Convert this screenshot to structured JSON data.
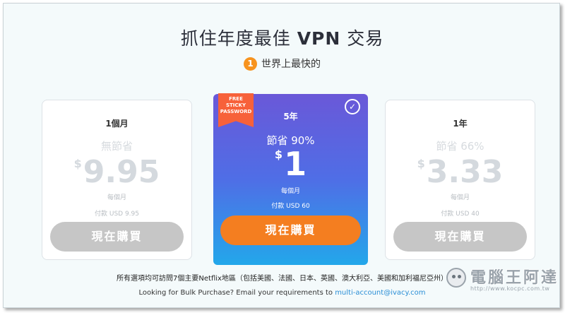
{
  "header": {
    "title_pre": "抓住年度最佳 ",
    "title_bold": "VPN",
    "title_post": " 交易",
    "feature_num": "1",
    "feature_text": "世界上最快的"
  },
  "plans": [
    {
      "period": "1個月",
      "save": "無節省",
      "currency": "$",
      "price": "9.95",
      "per": "每個月",
      "pay": "付款 USD 9.95",
      "button": "現在購買"
    },
    {
      "period": "5年",
      "save": "節省 90%",
      "currency": "$",
      "price": "1",
      "per": "每個月",
      "pay": "付款 USD 60",
      "button": "現在購買",
      "ribbon": [
        "FREE",
        "STICKY",
        "PASSWORD"
      ],
      "selected_icon": "check-circle-icon"
    },
    {
      "period": "1年",
      "save": "節省 66%",
      "currency": "$",
      "price": "3.33",
      "per": "每個月",
      "pay": "付款 USD 40",
      "button": "現在購買"
    }
  ],
  "footer": {
    "note": "所有選項均可訪問7個主要Netflix地區（包括美國、法國、日本、英國、澳大利亞、美國和加利福尼亞州）",
    "bulk_text": "Looking for Bulk Purchase? Email your requirements to ",
    "bulk_email": "multi-account@ivacy.com"
  },
  "watermark": {
    "brand": "電腦王阿達",
    "url": "http://www.kocpc.com.tw"
  },
  "colors": {
    "accent_orange": "#f47e20",
    "ribbon": "#f7613a",
    "gradient_top": "#6a58d8",
    "gradient_bottom": "#23a7ea",
    "link": "#2a8ed6"
  }
}
